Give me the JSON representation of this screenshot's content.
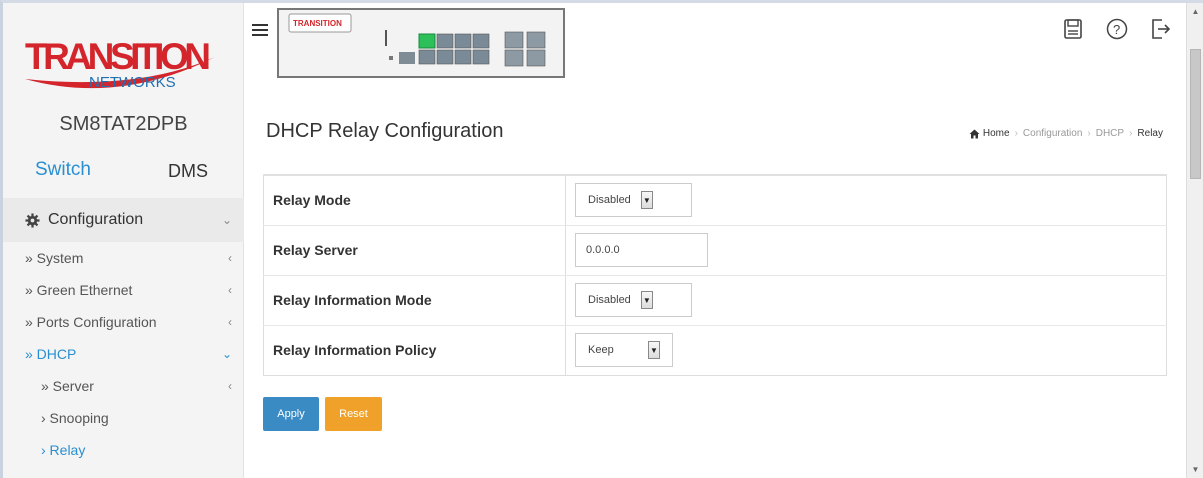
{
  "brand": {
    "logo_main": "TRANSITION",
    "logo_sub": "NETWORKS",
    "panel_logo": "TRANSITION"
  },
  "device": {
    "name": "SM8TAT2DPB"
  },
  "tabs": {
    "switch": "Switch",
    "dms": "DMS"
  },
  "nav": {
    "configuration": "Configuration",
    "system": "» System",
    "green_ethernet": "» Green Ethernet",
    "ports_configuration": "» Ports Configuration",
    "dhcp": "» DHCP",
    "server": "» Server",
    "snooping": "› Snooping",
    "relay": "› Relay"
  },
  "page": {
    "title": "DHCP Relay Configuration"
  },
  "breadcrumb": {
    "home": "Home",
    "configuration": "Configuration",
    "dhcp": "DHCP",
    "relay": "Relay"
  },
  "form": {
    "relay_mode": {
      "label": "Relay Mode",
      "value": "Disabled"
    },
    "relay_server": {
      "label": "Relay Server",
      "value": "0.0.0.0"
    },
    "relay_info_mode": {
      "label": "Relay Information Mode",
      "value": "Disabled"
    },
    "relay_info_policy": {
      "label": "Relay Information Policy",
      "value": "Keep"
    }
  },
  "buttons": {
    "apply": "Apply",
    "reset": "Reset"
  },
  "colors": {
    "accent": "#2a8fd0",
    "apply": "#3a8ac4",
    "reset": "#f0a12a",
    "logo_red": "#d3252b",
    "logo_blue": "#1f6fb3"
  }
}
